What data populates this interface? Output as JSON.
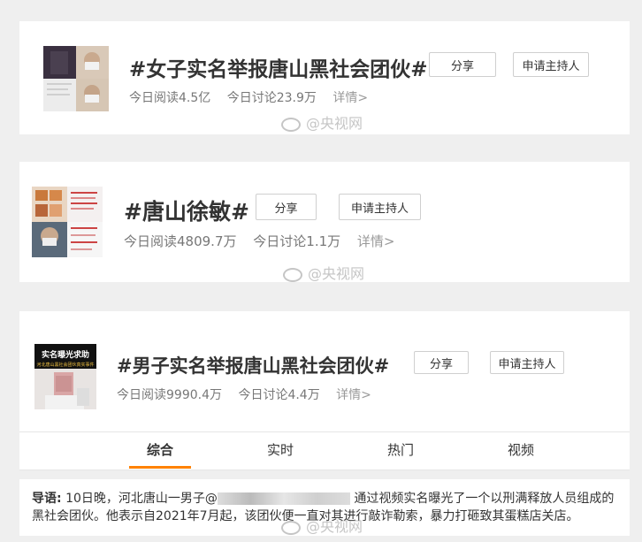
{
  "topics": [
    {
      "title": "#女子实名举报唐山黑社会团伙#",
      "reads_label": "今日阅读4.5亿",
      "discuss_label": "今日讨论23.9万",
      "detail_label": "详情>",
      "share_label": "分享",
      "host_label": "申请主持人"
    },
    {
      "title": "#唐山徐敏#",
      "reads_label": "今日阅读4809.7万",
      "discuss_label": "今日讨论1.1万",
      "detail_label": "详情>",
      "share_label": "分享",
      "host_label": "申请主持人"
    },
    {
      "title": "#男子实名举报唐山黑社会团伙#",
      "reads_label": "今日阅读9990.4万",
      "discuss_label": "今日讨论4.4万",
      "detail_label": "详情>",
      "share_label": "分享",
      "host_label": "申请主持人",
      "thumb_caption_1": "实名曝光求助",
      "thumb_caption_2": "河北唐山黑社会团伙真实事件"
    }
  ],
  "watermark": "@央视网",
  "tabs": [
    "综合",
    "实时",
    "热门",
    "视频"
  ],
  "active_tab": "综合",
  "lead": {
    "label": "导语:",
    "text_before": "10日晚，河北唐山一男子@",
    "text_after": "通过视频实名曝光了一个以刑满释放人员组成的黑社会团伙。他表示自2021年7月起，该团伙便一直对其进行敲诈勒索，暴力打砸致其蛋糕店关店。"
  },
  "colors": {
    "accent": "#ff8200",
    "background": "#efefef"
  }
}
